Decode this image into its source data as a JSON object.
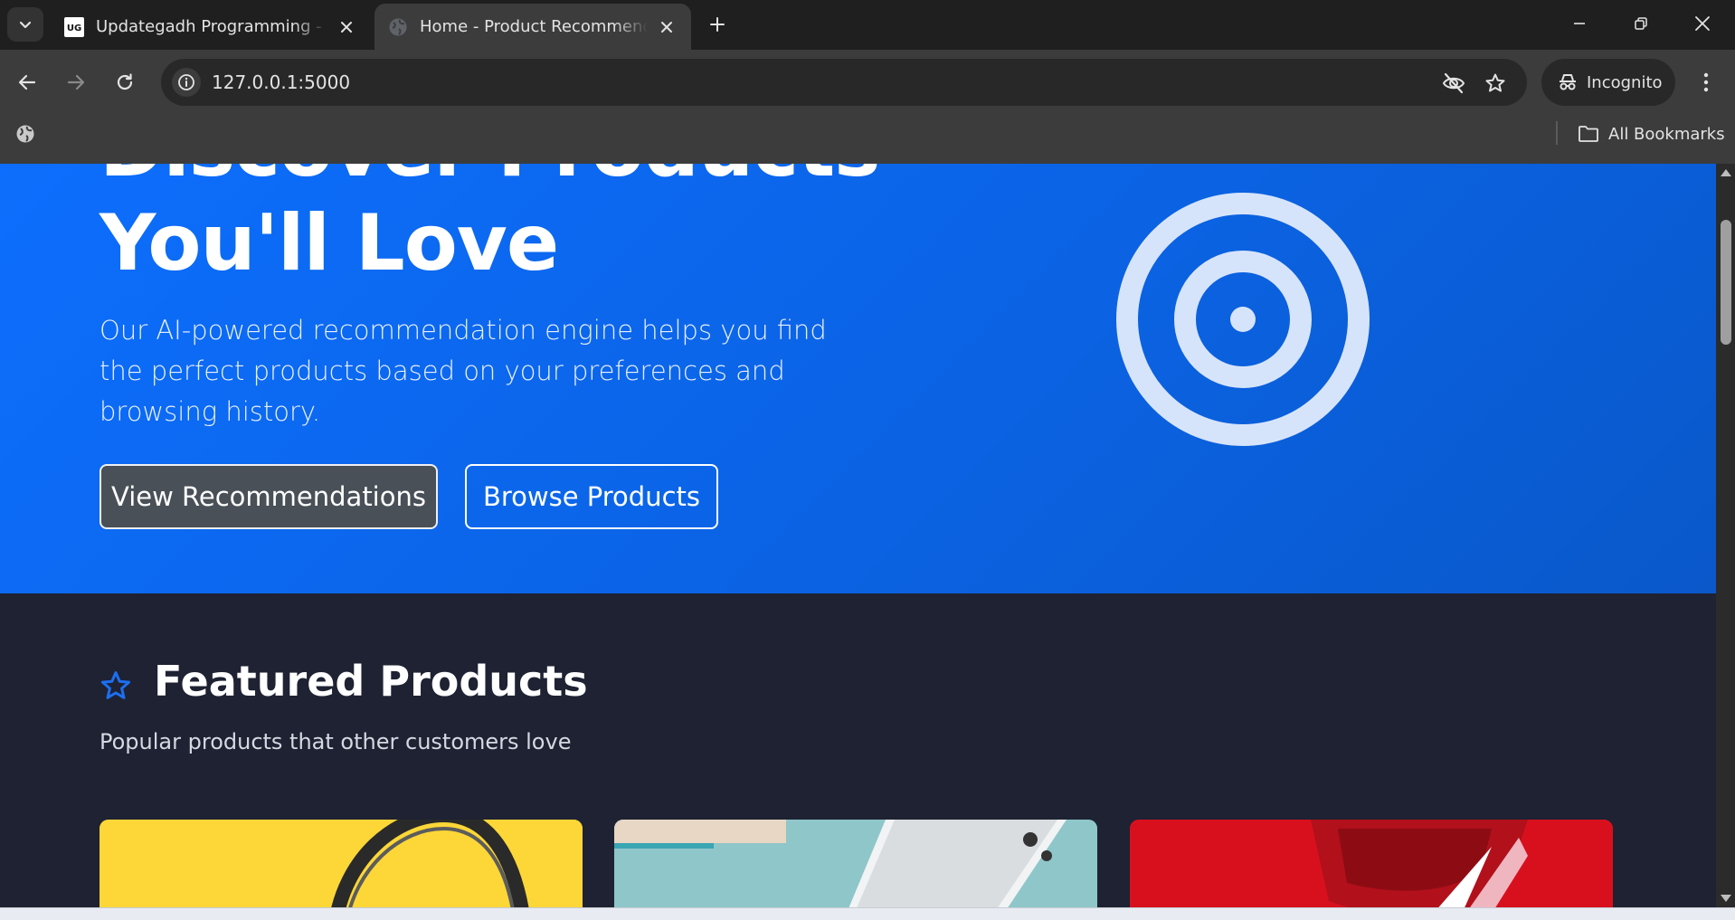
{
  "browser": {
    "tabs": [
      {
        "title": "Updategadh Programming - Updategadh",
        "favicon": "ug-logo-icon",
        "active": false
      },
      {
        "title": "Home - Product Recommendation",
        "favicon": "globe-icon",
        "active": true
      }
    ],
    "url": "127.0.0.1:5000",
    "incognito_label": "Incognito",
    "all_bookmarks_label": "All Bookmarks",
    "favicon_badge": "UG"
  },
  "hero": {
    "title_line1": "Discover Products",
    "title_line2": "You'll Love",
    "lead": "Our AI-powered recommendation engine helps you find the perfect products based on your preferences and browsing history.",
    "primary_button": "View Recommendations",
    "secondary_button": "Browse Products",
    "illustration_icon": "target-icon"
  },
  "featured": {
    "icon": "star-outline-icon",
    "title": "Featured Products",
    "subtitle": "Popular products that other customers love",
    "cards": [
      {
        "image": "headphones-yellow-background",
        "color": "#fcd737"
      },
      {
        "image": "phone-teal-background",
        "color": "#8fc6c9"
      },
      {
        "image": "red-sneaker-background",
        "color": "#d8101e"
      }
    ]
  },
  "colors": {
    "hero_blue": "#0d6efd",
    "page_dark": "#1e2232",
    "dark_button": "#495057"
  }
}
